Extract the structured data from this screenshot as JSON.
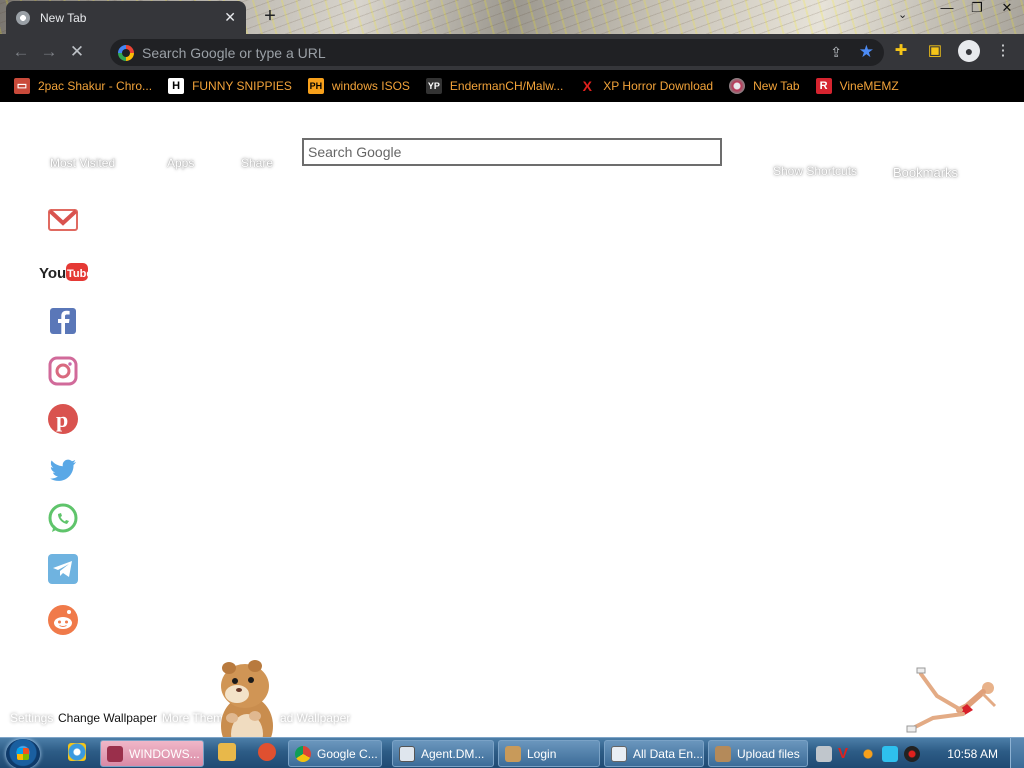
{
  "browser": {
    "tab_title": "New Tab",
    "new_tab_symbol": "+",
    "omnibox_placeholder": "Search Google or type a URL",
    "window_controls": {
      "minimize": "—",
      "restore": "❐",
      "close": "✕"
    }
  },
  "bookmarks": [
    {
      "label": "2pac Shakur - Chro...",
      "icon": "tape-icon",
      "color": "#f2a33a"
    },
    {
      "label": "FUNNY SNIPPIES",
      "icon": "h-logo-icon",
      "color": "#f2a33a"
    },
    {
      "label": "windows ISOS",
      "icon": "ph-logo-icon",
      "color": "#f2a33a"
    },
    {
      "label": "EndermanCH/Malw...",
      "icon": "yp-logo-icon",
      "color": "#f2a33a"
    },
    {
      "label": "XP Horror Download",
      "icon": "x-logo-icon",
      "color": "#f2a33a"
    },
    {
      "label": "New Tab",
      "icon": "globe-icon",
      "color": "#f2a33a"
    },
    {
      "label": "VineMEMZ",
      "icon": "r-logo-icon",
      "color": "#f2a33a"
    }
  ],
  "page": {
    "nav": {
      "most_visited": "Most Visited",
      "apps": "Apps",
      "share": "Share",
      "show_shortcuts": "Show Shortcuts",
      "bookmarks": "Bookmarks"
    },
    "search_placeholder": "Search Google",
    "bottom": {
      "settings": "Settings",
      "change_wallpaper": "Change Wallpaper",
      "more_themes": "More Them",
      "download_wallpaper": "ad Wallpaper"
    },
    "social": [
      "gmail-icon",
      "youtube-icon",
      "facebook-icon",
      "instagram-icon",
      "pinterest-icon",
      "twitter-icon",
      "whatsapp-icon",
      "telegram-icon",
      "reddit-icon"
    ],
    "youtube_label": "YouTube"
  },
  "taskbar": {
    "buttons": [
      {
        "label": "WINDOWS...",
        "active": true
      },
      {
        "label": "Google C...",
        "active": false
      },
      {
        "label": "Agent.DM...",
        "active": false
      },
      {
        "label": "Login",
        "active": false
      },
      {
        "label": "All Data En...",
        "active": false
      },
      {
        "label": "Upload files",
        "active": false
      }
    ],
    "clock": "10:58 AM"
  },
  "colors": {
    "accent": "#4c8bf5",
    "bookmark_text": "#f2a33a",
    "toolbar": "#35363a"
  }
}
